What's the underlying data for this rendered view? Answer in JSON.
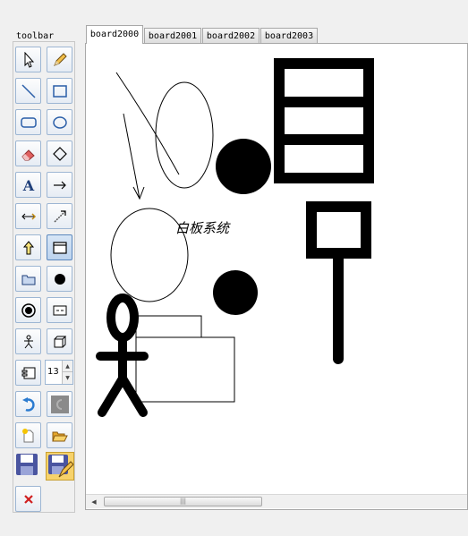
{
  "toolbar": {
    "title": "toolbar",
    "tools": [
      {
        "name": "select-tool",
        "icon": "arrow-pointer-icon"
      },
      {
        "name": "pencil-tool",
        "icon": "pencil-icon"
      },
      {
        "name": "line-tool",
        "icon": "diagonal-line-icon"
      },
      {
        "name": "rectangle-tool",
        "icon": "rectangle-icon"
      },
      {
        "name": "rounded-rectangle-tool",
        "icon": "rounded-rectangle-icon"
      },
      {
        "name": "ellipse-tool",
        "icon": "ellipse-icon"
      },
      {
        "name": "eraser-tool",
        "icon": "eraser-icon"
      },
      {
        "name": "diamond-tool",
        "icon": "diamond-icon"
      },
      {
        "name": "text-tool",
        "icon": "text-a-icon"
      },
      {
        "name": "arrow-tool",
        "icon": "right-arrow-icon"
      },
      {
        "name": "double-arrow-tool",
        "icon": "double-arrow-icon"
      },
      {
        "name": "connector-tool",
        "icon": "diagonal-arrow-icon"
      },
      {
        "name": "up-arrow-tool",
        "icon": "up-arrow-icon"
      },
      {
        "name": "window-tool",
        "icon": "window-icon"
      },
      {
        "name": "folder-shape-tool",
        "icon": "folder-shape-icon"
      },
      {
        "name": "filled-circle-tool",
        "icon": "filled-circle-icon"
      },
      {
        "name": "ring-circle-tool",
        "icon": "ring-circle-icon"
      },
      {
        "name": "textbox-tool",
        "icon": "textbox-icon"
      },
      {
        "name": "stick-figure-tool",
        "icon": "stick-figure-icon"
      },
      {
        "name": "cube-tool",
        "icon": "cube-icon"
      },
      {
        "name": "component-tool",
        "icon": "component-icon"
      },
      {
        "name": "undo-tool",
        "icon": "undo-icon"
      },
      {
        "name": "redo-tool",
        "icon": "redo-icon"
      },
      {
        "name": "new-file-tool",
        "icon": "new-file-icon"
      },
      {
        "name": "open-file-tool",
        "icon": "open-folder-icon"
      },
      {
        "name": "save-tool",
        "icon": "floppy-disk-icon"
      },
      {
        "name": "save-as-tool",
        "icon": "save-as-icon"
      },
      {
        "name": "clear-tool",
        "icon": "red-x-icon"
      }
    ],
    "pressed_tool": "window-tool",
    "stroke_size": "13"
  },
  "tabs": [
    "board2000",
    "board2001",
    "board2002",
    "board2003"
  ],
  "active_tab": "board2000",
  "board": {
    "text": "白板系统"
  },
  "scrollbar": {
    "thumb_grip": "|||"
  },
  "colors": {
    "pressed_button": "#bcd3ee",
    "button_border": "#9db6d3",
    "ink": "#000000",
    "eraser": "#e06060",
    "save_blue": "#4a55a0",
    "clear_red": "#d02020"
  }
}
